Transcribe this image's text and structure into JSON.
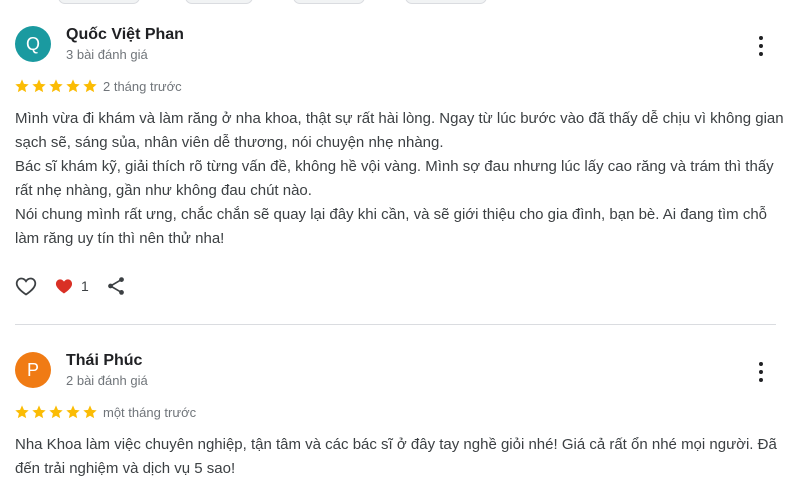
{
  "colors": {
    "avatar_q": "#1a9aa0",
    "avatar_p": "#f07b14",
    "star": "#fbbc04",
    "heart_red": "#d93025"
  },
  "reviews": [
    {
      "avatar_letter": "Q",
      "name": "Quốc Việt Phan",
      "review_count": "3 bài đánh giá",
      "rating": 5,
      "time": "2 tháng trước",
      "paragraphs": [
        "Mình vừa đi khám và làm răng ở nha khoa, thật sự rất hài lòng. Ngay từ lúc bước vào đã thấy dễ chịu vì không gian sạch sẽ, sáng sủa, nhân viên dễ thương, nói chuyện nhẹ nhàng.",
        "Bác sĩ khám kỹ, giải thích rõ từng vấn đề, không hề vội vàng. Mình sợ đau nhưng lúc lấy cao răng và trám thì thấy rất nhẹ nhàng, gần như không đau chút nào.",
        "Nói chung mình rất ưng, chắc chắn sẽ quay lại đây khi cần, và sẽ giới thiệu cho gia đình, bạn bè. Ai đang tìm chỗ làm răng uy tín thì nên thử nha!"
      ],
      "like_count": "1"
    },
    {
      "avatar_letter": "P",
      "name": "Thái Phúc",
      "review_count": "2 bài đánh giá",
      "rating": 5,
      "time": "một tháng trước",
      "paragraphs": [
        "Nha Khoa làm việc chuyên nghiệp, tận tâm và các bác sĩ ở đây tay nghề giỏi nhé! Giá cả rất ổn nhé mọi người. Đã đến trải nghiệm và dịch vụ 5 sao!"
      ]
    }
  ]
}
